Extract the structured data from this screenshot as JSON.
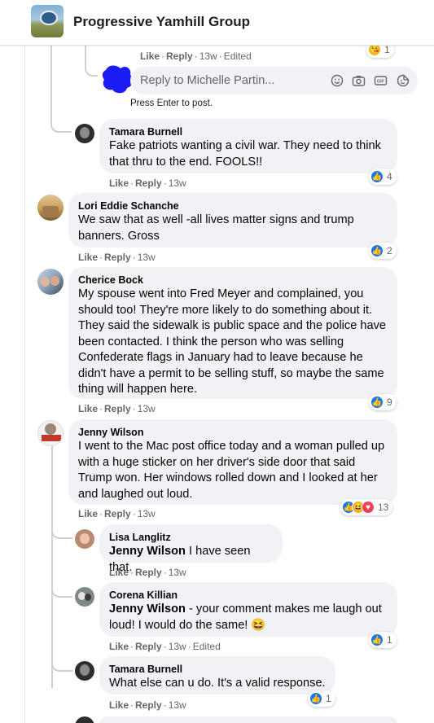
{
  "header": {
    "group_name": "Progressive Yamhill Group"
  },
  "top_actions": {
    "like": "Like",
    "reply": "Reply",
    "time": "13w",
    "edited": "Edited",
    "reaction_count": "1"
  },
  "reply_box": {
    "placeholder": "Reply to Michelle Partin...",
    "hint": "Press Enter to post."
  },
  "common": {
    "like": "Like",
    "reply": "Reply",
    "dot": "·"
  },
  "comments": [
    {
      "author": "Tamara Burnell",
      "text": "Fake patriots wanting a civil war. They need to think that thru to the end. FOOLS!!",
      "time": "13w",
      "reactions": "4"
    },
    {
      "author": "Lori Eddie Schanche",
      "text": "We saw that as well -all lives matter signs and trump banners. Gross",
      "time": "13w",
      "reactions": "2"
    },
    {
      "author": "Cherice Bock",
      "text": "My spouse went into Fred Meyer and complained, you should too! They're more likely to do something about it. They said the sidewalk is public space and the police have been contacted. I think the person who was selling Confederate flags in January had to leave because he didn't have a permit to be selling stuff, so maybe the same thing will happen here.",
      "time": "13w",
      "reactions": "9"
    },
    {
      "author": "Jenny Wilson",
      "text": "I went to the Mac post office today and a woman pulled up with a huge sticker on her driver's side door that said Trump won. Her windows rolled down and I looked at her and laughed out loud.",
      "time": "13w",
      "reactions": "13"
    },
    {
      "author": "Lisa Langlitz",
      "mention": "Jenny Wilson",
      "text": "I have seen that.",
      "time": "13w"
    },
    {
      "author": "Corena Killian",
      "mention": "Jenny Wilson",
      "text": "- your comment makes me laugh out loud! I would do the same! 😆",
      "time": "13w",
      "edited": "Edited",
      "reactions": "1"
    },
    {
      "author": "Tamara Burnell",
      "text": "What else can u do. It's a valid response.",
      "time": "13w",
      "reactions": "1"
    }
  ],
  "colors": {
    "link_blue": "#1877f2",
    "bubble": "#f0f2f5",
    "meta": "#65676b"
  }
}
